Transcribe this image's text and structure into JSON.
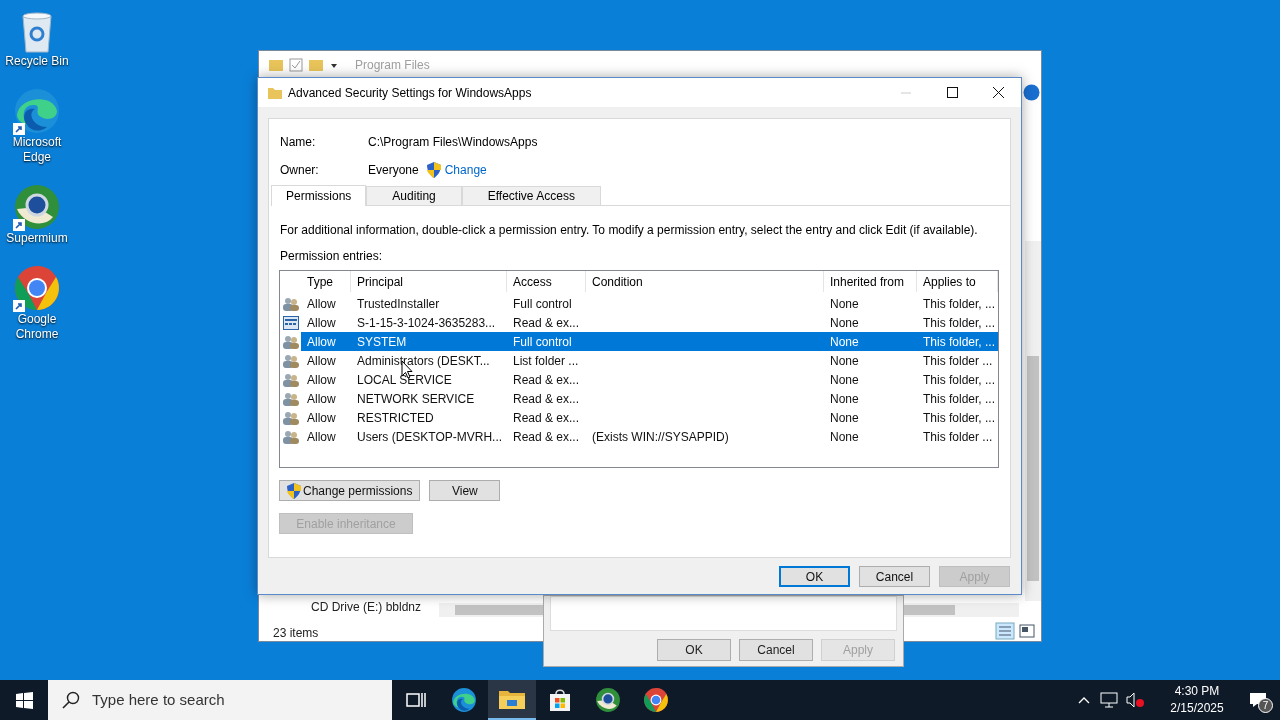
{
  "desktop_icons": [
    {
      "label": "Recycle Bin",
      "kind": "recycle",
      "shortcut": false
    },
    {
      "label": "Microsoft Edge",
      "kind": "edge",
      "shortcut": true
    },
    {
      "label": "Supermium",
      "kind": "supermium",
      "shortcut": true
    },
    {
      "label": "Google Chrome",
      "kind": "chrome",
      "shortcut": true
    }
  ],
  "explorer": {
    "title": "Program Files",
    "partial_item": "CD Drive (E:) bbldnz",
    "status": "23 items"
  },
  "properties_dialog": {
    "buttons": [
      {
        "label": "OK",
        "disabled": false
      },
      {
        "label": "Cancel",
        "disabled": false
      },
      {
        "label": "Apply",
        "disabled": true
      }
    ]
  },
  "dialog": {
    "title": "Advanced Security Settings for WindowsApps",
    "name_label": "Name:",
    "name_value": "C:\\Program Files\\WindowsApps",
    "owner_label": "Owner:",
    "owner_value": "Everyone",
    "change_link": "Change",
    "tabs": [
      {
        "label": "Permissions",
        "selected": true
      },
      {
        "label": "Auditing",
        "selected": false
      },
      {
        "label": "Effective Access",
        "selected": false
      }
    ],
    "info": "For additional information, double-click a permission entry. To modify a permission entry, select the entry and click Edit (if available).",
    "entries_label": "Permission entries:",
    "table": {
      "columns": [
        "Type",
        "Principal",
        "Access",
        "Condition",
        "Inherited from",
        "Applies to"
      ],
      "rows": [
        {
          "kind": "group",
          "selected": false,
          "cells": [
            "Allow",
            "TrustedInstaller",
            "Full control",
            "",
            "None",
            "This folder, ..."
          ]
        },
        {
          "kind": "app",
          "selected": false,
          "cells": [
            "Allow",
            "S-1-15-3-1024-3635283...",
            "Read & ex...",
            "",
            "None",
            "This folder, ..."
          ]
        },
        {
          "kind": "group",
          "selected": true,
          "cells": [
            "Allow",
            "SYSTEM",
            "Full control",
            "",
            "None",
            "This folder, ..."
          ]
        },
        {
          "kind": "group",
          "selected": false,
          "cells": [
            "Allow",
            "Administrators (DESKT...",
            "List folder ...",
            "",
            "None",
            "This folder ..."
          ]
        },
        {
          "kind": "group",
          "selected": false,
          "cells": [
            "Allow",
            "LOCAL SERVICE",
            "Read & ex...",
            "",
            "None",
            "This folder, ..."
          ]
        },
        {
          "kind": "group",
          "selected": false,
          "cells": [
            "Allow",
            "NETWORK SERVICE",
            "Read & ex...",
            "",
            "None",
            "This folder, ..."
          ]
        },
        {
          "kind": "group",
          "selected": false,
          "cells": [
            "Allow",
            "RESTRICTED",
            "Read & ex...",
            "",
            "None",
            "This folder, ..."
          ]
        },
        {
          "kind": "group",
          "selected": false,
          "cells": [
            "Allow",
            "Users (DESKTOP-MVRH...",
            "Read & ex...",
            "(Exists WIN://SYSAPPID)",
            "None",
            "This folder ..."
          ]
        }
      ]
    },
    "actions": [
      {
        "label": "Change permissions",
        "shield": true,
        "disabled": false
      },
      {
        "label": "View",
        "shield": false,
        "disabled": false
      }
    ],
    "inheritance_button": {
      "label": "Enable inheritance",
      "disabled": true
    },
    "buttons": [
      {
        "label": "OK",
        "disabled": false,
        "default": true
      },
      {
        "label": "Cancel",
        "disabled": false,
        "default": false
      },
      {
        "label": "Apply",
        "disabled": true,
        "default": false
      }
    ]
  },
  "taskbar": {
    "search_placeholder": "Type here to search",
    "apps": [
      {
        "kind": "taskview",
        "active": false
      },
      {
        "kind": "edge",
        "active": false
      },
      {
        "kind": "explorer",
        "active": true
      },
      {
        "kind": "store",
        "active": false
      },
      {
        "kind": "supermium",
        "active": false
      },
      {
        "kind": "chrome",
        "active": false
      }
    ],
    "time": "4:30 PM",
    "date": "2/15/2025",
    "notification_count": "7"
  }
}
